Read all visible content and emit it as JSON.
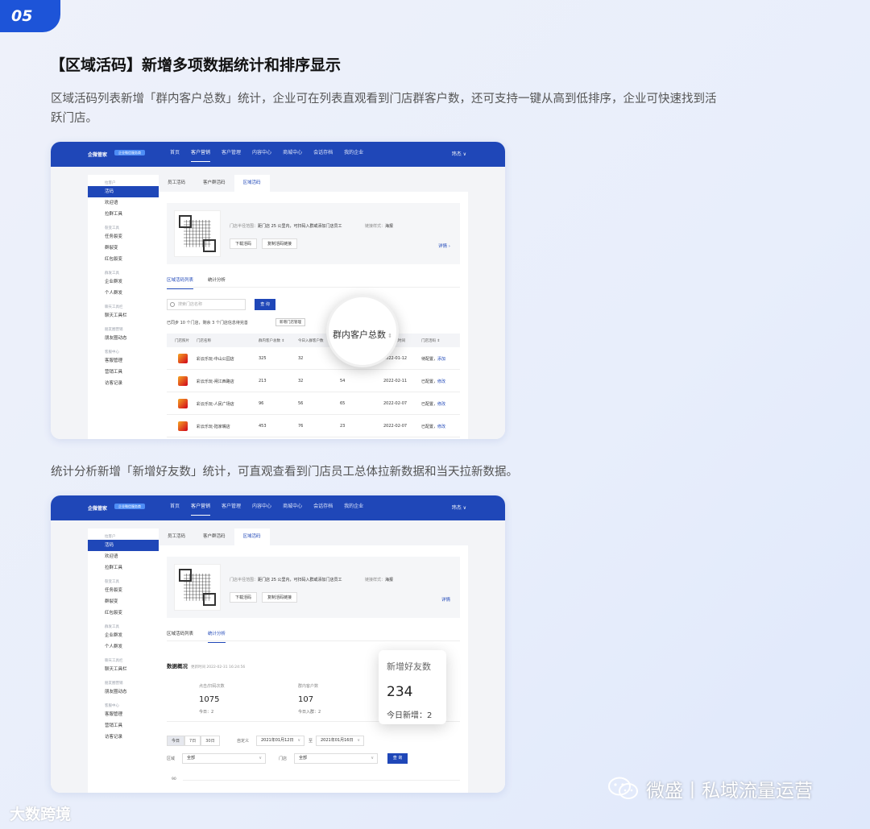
{
  "badge": "05",
  "heading": "【区域活码】新增多项数据统计和排序显示",
  "description": "区域活码列表新增「群内客户总数」统计，企业可在列表直观看到门店群客户数，还可支持一键从高到低排序，企业可快速找到活跃门店。",
  "description2": "统计分析新增「新增好友数」统计，可直观查看到门店员工总体拉新数据和当天拉新数据。",
  "app": {
    "brand": "企微管家",
    "brand_tag": "企业微信服务商",
    "nav": [
      "首页",
      "客户营销",
      "客户管理",
      "内容中心",
      "商城中心",
      "会话存档",
      "我的企业"
    ],
    "nav_active": 1,
    "user": "玮杰 ∨",
    "sidebar": [
      {
        "group": "拉客户",
        "items": [
          "活码",
          "欢迎语",
          "拉群工具"
        ]
      },
      {
        "group": "裂变工具",
        "items": [
          "任务裂变",
          "群裂变",
          "红包裂变"
        ]
      },
      {
        "group": "群发工具",
        "items": [
          "企业群发",
          "个人群发"
        ]
      },
      {
        "group": "聊天工具栏",
        "items": [
          "聊天工具栏"
        ]
      },
      {
        "group": "朋友圈营销",
        "items": [
          "朋友圈动态"
        ]
      },
      {
        "group": "客服中心",
        "items": [
          "客服管理",
          "营销工具",
          "访客记录"
        ]
      }
    ],
    "tabs": [
      "员工活码",
      "客户群活码",
      "区域活码"
    ],
    "qr_radius_label": "门店半径范围：",
    "qr_radius_value": "距门店 25 公里内，可扫码入群或添加门店员工",
    "qr_style_label": "链接样式：",
    "qr_style_value": "海报",
    "btn_download": "下载活码",
    "btn_copy": "复制活码链接",
    "detail": "详情 ›",
    "detail2": "详情",
    "subtabs": [
      "区域活码列表",
      "统计分析"
    ]
  },
  "list": {
    "search_placeholder": "搜索门店名称",
    "query_btn": "查 询",
    "sync_text": "已同步 10 个门店，剩余 3 个门店信息待完善",
    "sync_btn": "新增门店管理",
    "columns": [
      "门店照片",
      "门店名称",
      "群内客户总数 ⇕",
      "今日入群客户数",
      "",
      "最近更新时间",
      "门店活码 ⇕"
    ],
    "rows": [
      {
        "name": "彩云乐玩-中山公园店",
        "total": "325",
        "today": "32",
        "c3": "",
        "date": "2022-01-12",
        "status": "待配置，",
        "action": "添加"
      },
      {
        "name": "彩云乐玩-闸江西路店",
        "total": "213",
        "today": "32",
        "c3": "54",
        "date": "2022-02-11",
        "status": "已配置，",
        "action": "修改"
      },
      {
        "name": "彩云乐玩-人民广场店",
        "total": "96",
        "today": "56",
        "c3": "65",
        "date": "2022-02-07",
        "status": "已配置，",
        "action": "修改"
      },
      {
        "name": "彩云乐玩-陆家嘴店",
        "total": "453",
        "today": "76",
        "c3": "23",
        "date": "2022-02-07",
        "status": "已配置，",
        "action": "修改"
      }
    ],
    "magnifier_label": "群内客户总数",
    "magnifier_sort": "⇕"
  },
  "stats": {
    "title": "数据概况",
    "updated": "更新时间 2022-02-31 16:24:56",
    "metric1_label": "点击/扫码次数",
    "metric1_value": "1075",
    "metric1_sub": "今日：2",
    "metric2_label": "群内客户数",
    "metric2_value": "107",
    "metric2_sub": "今日入群：2",
    "range_tabs": [
      "今日",
      "7日",
      "30日"
    ],
    "custom_label": "自定义",
    "date_from": "2021年01月12日",
    "date_to_label": "至",
    "date_to": "2021年01月16日",
    "region_label": "区域",
    "region_value": "全部",
    "store_label": "门店",
    "store_value": "全部",
    "query_btn": "查 询",
    "axis_label": "90",
    "popup_title": "新增好友数",
    "popup_value": "234",
    "popup_sub": "今日新增：2"
  },
  "watermark_left": "大数跨境",
  "watermark_right": "微盛丨私域流量运营"
}
